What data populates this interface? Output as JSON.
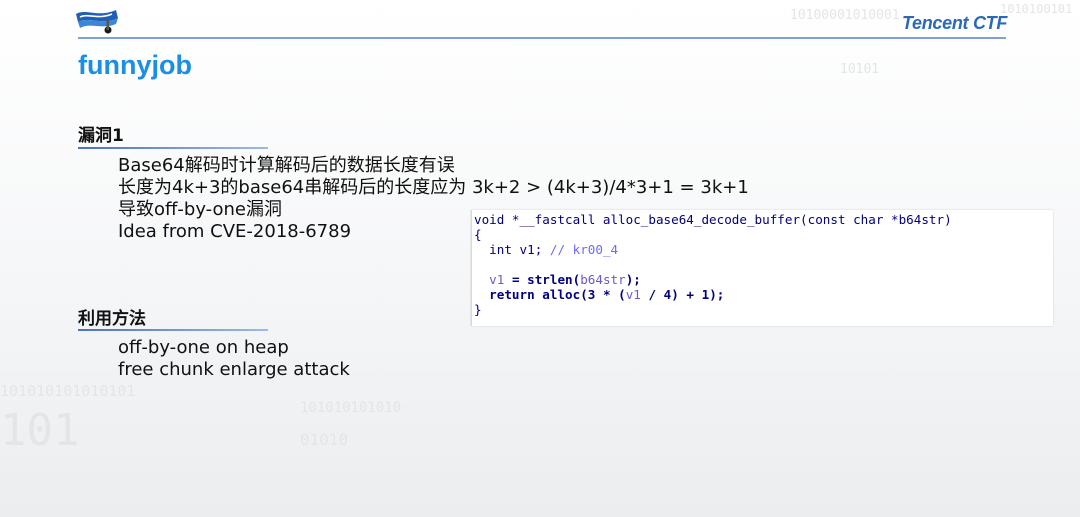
{
  "brand": "Tencent CTF",
  "title": "funnyjob",
  "sections": {
    "vuln": {
      "heading": "漏洞1",
      "lines": [
        "Base64解码时计算解码后的数据长度有误",
        "长度为4k+3的base64串解码后的长度应为 3k+2 > (4k+3)/4*3+1 = 3k+1",
        "导致off-by-one漏洞",
        "Idea from CVE-2018-6789"
      ]
    },
    "exploit": {
      "heading": "利用方法",
      "lines": [
        "off-by-one on heap",
        "free chunk enlarge attack"
      ]
    }
  },
  "code": {
    "signature": "void *__fastcall alloc_base64_decode_buffer(const char *b64str)",
    "open_brace": "{",
    "decl_type": "int",
    "decl_var": "v1",
    "decl_comment": "// kr00_4",
    "assign_var": "v1",
    "assign_func": "strlen",
    "assign_arg": "b64str",
    "ret_kw": "return",
    "ret_func": "alloc",
    "ret_expr_a": "3",
    "ret_expr_var": "v1",
    "ret_expr_b": "4",
    "ret_expr_c": "1",
    "close_brace": "}"
  },
  "background_digits": [
    "10100001010001",
    "1010100101",
    "10101",
    "101010101010101",
    "101010101010",
    "01010",
    "101"
  ],
  "colors": {
    "accent": "#1b8ee6",
    "brand": "#2b68b8",
    "rule": "#7ea0d8"
  }
}
